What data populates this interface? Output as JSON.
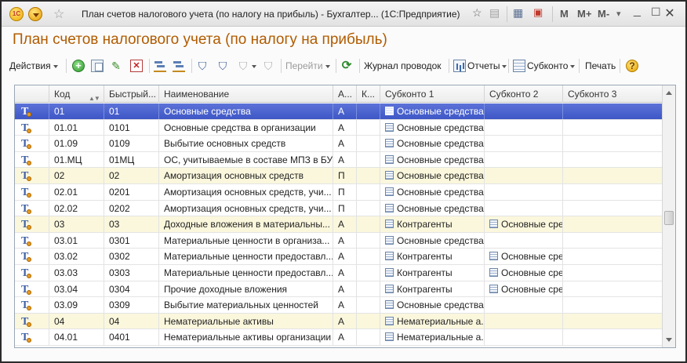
{
  "window": {
    "title": "План счетов налогового учета (по налогу на прибыль) - Бухгалтер...  (1С:Предприятие)",
    "logo_label": "1С",
    "mem_buttons": [
      "M",
      "M+",
      "M-"
    ]
  },
  "page": {
    "heading": "План счетов налогового учета (по налогу на прибыль)"
  },
  "toolbar": {
    "actions_label": "Действия",
    "goto_label": "Перейти",
    "journal_label": "Журнал проводок",
    "reports_label": "Отчеты",
    "subconto_label": "Субконто",
    "print_label": "Печать",
    "help_label": "?"
  },
  "table": {
    "columns": [
      "Код",
      "Быстрый...",
      "Наименование",
      "А...",
      "К...",
      "Субконто 1",
      "Субконто 2",
      "Субконто 3"
    ],
    "sort_icon": "▲▼",
    "rows": [
      {
        "code": "01",
        "quick": "01",
        "name": "Основные средства",
        "a": "А",
        "k": "",
        "s1": "Основные средства",
        "s2": "",
        "s3": "",
        "kind": "sel"
      },
      {
        "code": "01.01",
        "quick": "0101",
        "name": "Основные средства в организации",
        "a": "А",
        "k": "",
        "s1": "Основные средства",
        "s2": "",
        "s3": "",
        "kind": "even"
      },
      {
        "code": "01.09",
        "quick": "0109",
        "name": "Выбытие основных средств",
        "a": "А",
        "k": "",
        "s1": "Основные средства",
        "s2": "",
        "s3": "",
        "kind": "even"
      },
      {
        "code": "01.МЦ",
        "quick": "01МЦ",
        "name": "ОС, учитываемые в составе МПЗ в БУ",
        "a": "А",
        "k": "",
        "s1": "Основные средства",
        "s2": "",
        "s3": "",
        "kind": "even"
      },
      {
        "code": "02",
        "quick": "02",
        "name": "Амортизация основных средств",
        "a": "П",
        "k": "",
        "s1": "Основные средства",
        "s2": "",
        "s3": "",
        "kind": "group"
      },
      {
        "code": "02.01",
        "quick": "0201",
        "name": "Амортизация основных средств, учи...",
        "a": "П",
        "k": "",
        "s1": "Основные средства",
        "s2": "",
        "s3": "",
        "kind": "even"
      },
      {
        "code": "02.02",
        "quick": "0202",
        "name": "Амортизация основных средств, учи...",
        "a": "П",
        "k": "",
        "s1": "Основные средства",
        "s2": "",
        "s3": "",
        "kind": "even"
      },
      {
        "code": "03",
        "quick": "03",
        "name": "Доходные вложения в материальны...",
        "a": "А",
        "k": "",
        "s1": "Контрагенты",
        "s2": "Основные сре...",
        "s3": "",
        "kind": "group"
      },
      {
        "code": "03.01",
        "quick": "0301",
        "name": "Материальные ценности в организа...",
        "a": "А",
        "k": "",
        "s1": "Основные средства",
        "s2": "",
        "s3": "",
        "kind": "even"
      },
      {
        "code": "03.02",
        "quick": "0302",
        "name": "Материальные ценности предоставл...",
        "a": "А",
        "k": "",
        "s1": "Контрагенты",
        "s2": "Основные сре...",
        "s3": "",
        "kind": "even"
      },
      {
        "code": "03.03",
        "quick": "0303",
        "name": "Материальные ценности предоставл...",
        "a": "А",
        "k": "",
        "s1": "Контрагенты",
        "s2": "Основные сре...",
        "s3": "",
        "kind": "even"
      },
      {
        "code": "03.04",
        "quick": "0304",
        "name": "Прочие доходные вложения",
        "a": "А",
        "k": "",
        "s1": "Контрагенты",
        "s2": "Основные сре...",
        "s3": "",
        "kind": "even"
      },
      {
        "code": "03.09",
        "quick": "0309",
        "name": "Выбытие материальных ценностей",
        "a": "А",
        "k": "",
        "s1": "Основные средства",
        "s2": "",
        "s3": "",
        "kind": "even"
      },
      {
        "code": "04",
        "quick": "04",
        "name": "Нематериальные активы",
        "a": "А",
        "k": "",
        "s1": "Нематериальные а...",
        "s2": "",
        "s3": "",
        "kind": "group"
      },
      {
        "code": "04.01",
        "quick": "0401",
        "name": "Нематериальные активы организации",
        "a": "А",
        "k": "",
        "s1": "Нематериальные а...",
        "s2": "",
        "s3": "",
        "kind": "even"
      }
    ]
  },
  "colors": {
    "heading": "#b15b00",
    "selected_row": "#4a62cf",
    "group_row": "#fbf7dd"
  }
}
